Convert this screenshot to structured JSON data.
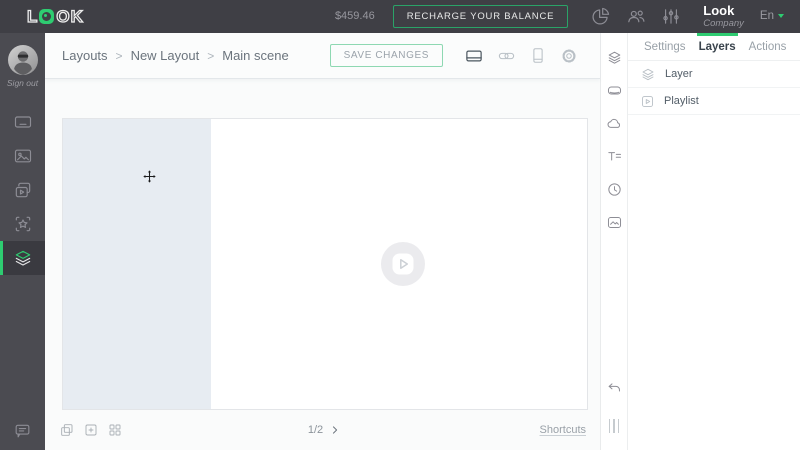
{
  "colors": {
    "accent": "#2ecc71",
    "topbar_bg": "#3f3f45",
    "sidebar_bg": "#4b4b51",
    "layer_region": "#e7ecf2"
  },
  "topbar": {
    "logo_letters": {
      "l": "L",
      "o": "O",
      "k": "K"
    },
    "balance": "$459.46",
    "recharge_button": "RECHARGE YOUR BALANCE",
    "account_name": "Look",
    "account_type": "Company",
    "language": "En"
  },
  "sidebar": {
    "sign_out": "Sign out"
  },
  "toolbar": {
    "breadcrumb": [
      "Layouts",
      "New Layout",
      "Main scene"
    ],
    "separator": ">",
    "save_button": "SAVE CHANGES"
  },
  "panel": {
    "tabs": [
      {
        "label": "Settings",
        "active": false
      },
      {
        "label": "Layers",
        "active": true
      },
      {
        "label": "Actions",
        "active": false
      }
    ],
    "layers": [
      {
        "label": "Layer",
        "icon": "layers-icon"
      },
      {
        "label": "Playlist",
        "icon": "playlist-icon"
      }
    ]
  },
  "canvas_footer": {
    "page_indicator": "1/2",
    "shortcuts": "Shortcuts"
  },
  "icons": {
    "pie-chart-icon": "statistics pie",
    "users-icon": "user group",
    "sliders-icon": "vertical sliders",
    "screens-icon": "display rectangle",
    "media-icon": "picture",
    "playlists-icon": "stacked video",
    "widgets-icon": "star in frame",
    "layers-icon": "stacked layers",
    "feedback-icon": "chat bubble",
    "landscape-icon": "horizontal screen",
    "link-icon": "chain link",
    "portrait-icon": "vertical screen",
    "gear-icon": "settings gear",
    "cloud-icon": "cloud",
    "text-icon": "T with lines",
    "clock-icon": "clock",
    "image-icon": "image frame",
    "undo-icon": "curved back arrow",
    "drag-handle-icon": "three vertical bars",
    "duplicate-icon": "two squares",
    "add-icon": "square plus",
    "grid-icon": "four squares",
    "move-cursor-icon": "move crosshair",
    "play-icon": "play in rounded square"
  }
}
